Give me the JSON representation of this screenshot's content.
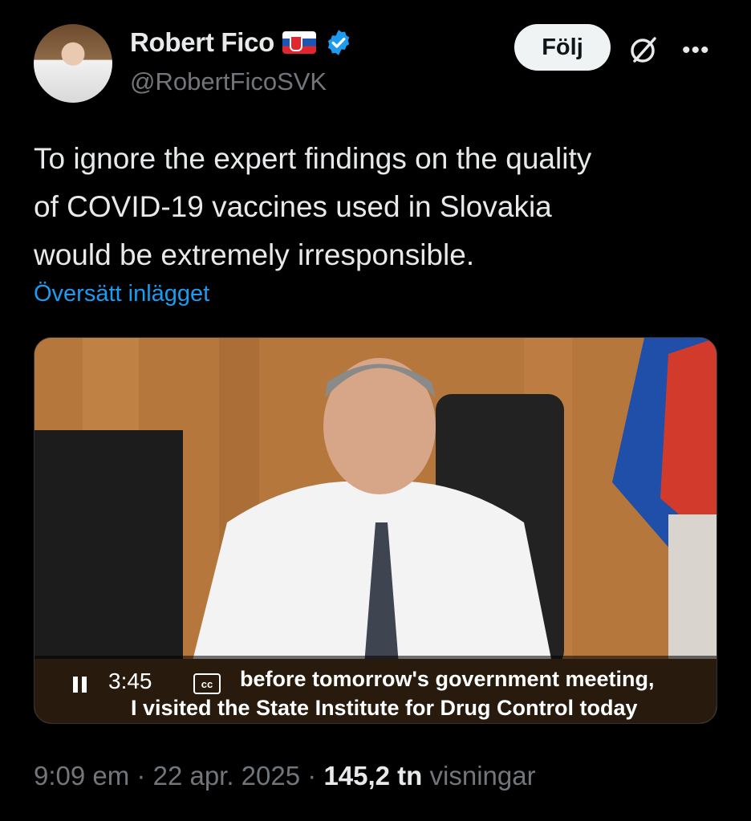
{
  "author": {
    "name": "Robert Fico",
    "handle": "@RobertFicoSVK"
  },
  "actions": {
    "follow_label": "Följ"
  },
  "tweet": {
    "lines": [
      "To ignore the expert findings on the quality",
      "of COVID-19 vaccines used in Slovakia",
      "would be extremely irresponsible."
    ],
    "translate_label": "Översätt inlägget"
  },
  "video": {
    "time_remaining": "3:45",
    "subtitle_line1": "before tomorrow's government meeting,",
    "subtitle_line2": "I visited the State Institute for Drug Control today",
    "cc_label": "cc"
  },
  "meta": {
    "time": "9:09 em",
    "date": "22 apr. 2025",
    "views_count": "145,2 tn",
    "views_label": "visningar"
  },
  "colors": {
    "background": "#000000",
    "link": "#1d9bf0",
    "secondary_text": "#71767b",
    "verified": "#1d9bf0"
  }
}
